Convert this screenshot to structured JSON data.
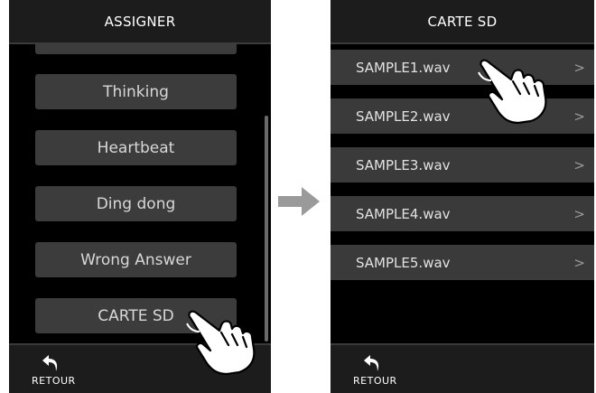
{
  "left_screen": {
    "title": "ASSIGNER",
    "items": [
      {
        "label": ""
      },
      {
        "label": "Thinking"
      },
      {
        "label": "Heartbeat"
      },
      {
        "label": "Ding dong"
      },
      {
        "label": "Wrong Answer"
      },
      {
        "label": "CARTE SD"
      }
    ],
    "back_label": "RETOUR"
  },
  "right_screen": {
    "title": "CARTE SD",
    "items": [
      {
        "label": "SAMPLE1.wav",
        "chevron": ">"
      },
      {
        "label": "SAMPLE2.wav",
        "chevron": ">"
      },
      {
        "label": "SAMPLE3.wav",
        "chevron": ">"
      },
      {
        "label": "SAMPLE4.wav",
        "chevron": ">"
      },
      {
        "label": "SAMPLE5.wav",
        "chevron": ">"
      }
    ],
    "back_label": "RETOUR"
  },
  "icons": {
    "back": "back-arrow-icon",
    "transition": "right-arrow-icon",
    "tap": "tap-hand-icon"
  },
  "colors": {
    "screen_background": "#000000",
    "item_background": "#3c3c3c",
    "transition_arrow": "#9a9a9a"
  }
}
